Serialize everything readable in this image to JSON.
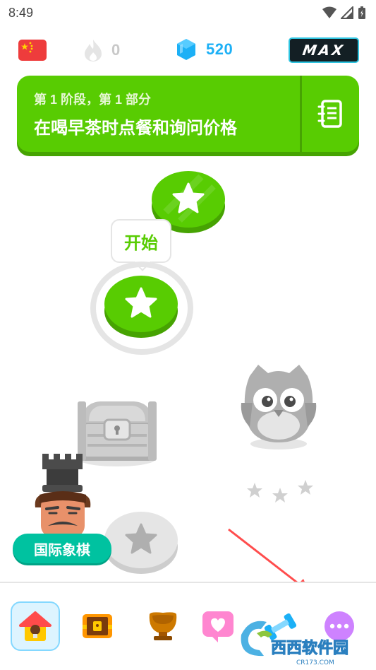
{
  "status_bar": {
    "time": "8:49"
  },
  "top_bar": {
    "flag_icon": "china-flag-icon",
    "streak_count": "0",
    "gems_count": "520",
    "max_label": "MAX",
    "colors": {
      "gems": "#1cb0f6",
      "streak_inactive": "#c9c9c9"
    }
  },
  "unit": {
    "subtitle": "第 1 阶段，第 1 部分",
    "title": "在喝早茶时点餐和询问价格",
    "color": "#58cc02"
  },
  "path": {
    "start_tooltip": "开始",
    "chess_label": "国际象棋",
    "nodes": [
      "completed",
      "current",
      "chest-locked",
      "owl-locked",
      "locked"
    ]
  },
  "tab_bar": {
    "tabs": [
      {
        "icon": "home-icon",
        "active": true
      },
      {
        "icon": "chest-icon",
        "active": false
      },
      {
        "icon": "league-icon",
        "active": false
      },
      {
        "icon": "health-icon",
        "active": false
      },
      {
        "icon": "practice-icon",
        "active": false
      },
      {
        "icon": "more-icon",
        "active": false
      }
    ]
  },
  "watermark": {
    "text": "西西软件园",
    "subtext": "CR173.COM"
  }
}
